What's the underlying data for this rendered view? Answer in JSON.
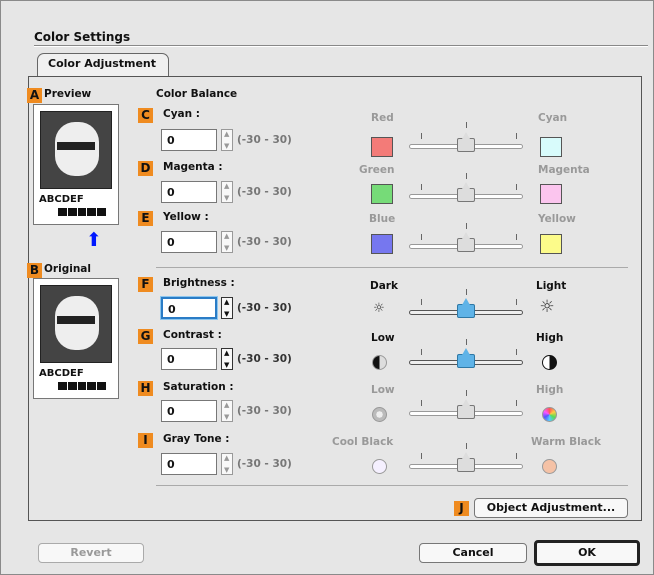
{
  "window": {
    "title": "Color Settings",
    "tab": "Color Adjustment"
  },
  "badges": {
    "a": "A",
    "b": "B",
    "c": "C",
    "d": "D",
    "e": "E",
    "f": "F",
    "g": "G",
    "h": "H",
    "i": "I",
    "j": "J"
  },
  "preview": {
    "label": "Preview",
    "sample_text": "ABCDEF"
  },
  "original": {
    "label": "Original",
    "sample_text": "ABCDEF"
  },
  "color_balance": {
    "heading": "Color Balance",
    "cyan": {
      "label": "Cyan :",
      "value": "0",
      "range": "(-30 - 30)",
      "left": "Red",
      "right": "Cyan",
      "left_color": "#f37b78",
      "right_color": "#d8fbfb"
    },
    "magenta": {
      "label": "Magenta :",
      "value": "0",
      "range": "(-30 - 30)",
      "left": "Green",
      "right": "Magenta",
      "left_color": "#76db78",
      "right_color": "#fbc5ee"
    },
    "yellow": {
      "label": "Yellow :",
      "value": "0",
      "range": "(-30 - 30)",
      "left": "Blue",
      "right": "Yellow",
      "left_color": "#7677ef",
      "right_color": "#fcfb8a"
    }
  },
  "adjustments": {
    "brightness": {
      "label": "Brightness :",
      "value": "0",
      "range": "(-30 - 30)",
      "left": "Dark",
      "right": "Light"
    },
    "contrast": {
      "label": "Contrast :",
      "value": "0",
      "range": "(-30 - 30)",
      "left": "Low",
      "right": "High"
    },
    "saturation": {
      "label": "Saturation :",
      "value": "0",
      "range": "(-30 - 30)",
      "left": "Low",
      "right": "High"
    },
    "gray_tone": {
      "label": "Gray Tone :",
      "value": "0",
      "range": "(-30 - 30)",
      "left": "Cool Black",
      "right": "Warm Black"
    }
  },
  "buttons": {
    "object_adjustment": "Object Adjustment...",
    "revert": "Revert",
    "cancel": "Cancel",
    "ok": "OK"
  }
}
